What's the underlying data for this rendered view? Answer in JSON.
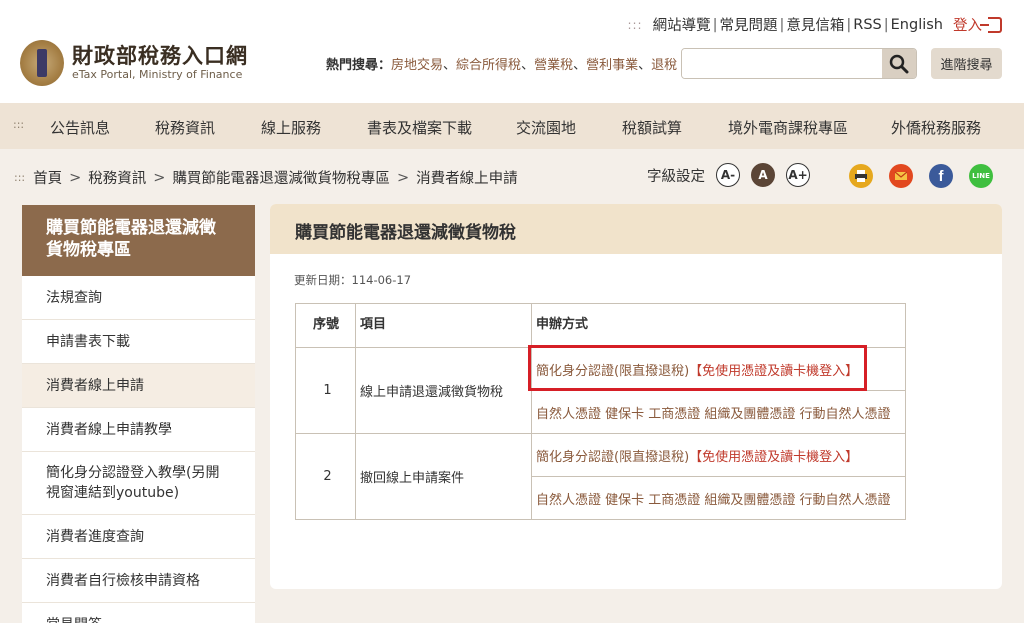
{
  "header": {
    "logo_cn": "財政部稅務入口網",
    "logo_en": "eTax Portal, Ministry of Finance",
    "toplinks": [
      "網站導覽",
      "常見問題",
      "意見信箱",
      "RSS",
      "English"
    ],
    "login": "登入",
    "hot_label": "熱門搜尋：",
    "hot_keywords": [
      "房地交易",
      "綜合所得稅",
      "營業稅",
      "營利事業",
      "退稅"
    ],
    "search_placeholder": "",
    "advanced_search": "進階搜尋"
  },
  "nav": {
    "items": [
      "公告訊息",
      "稅務資訊",
      "線上服務",
      "書表及檔案下載",
      "交流園地",
      "稅額試算",
      "境外電商課稅專區",
      "外僑稅務服務"
    ]
  },
  "breadcrumb": [
    "首頁",
    "稅務資訊",
    "購買節能電器退還減徵貨物稅專區",
    "消費者線上申請"
  ],
  "fontsize": {
    "label": "字級設定",
    "small": "A-",
    "normal": "A",
    "large": "A+"
  },
  "share_icons": [
    "print-icon",
    "mail-icon",
    "facebook-icon",
    "line-icon"
  ],
  "sidebar": {
    "title": "購買節能電器退還減徵貨物稅專區",
    "items": [
      "法規查詢",
      "申請書表下載",
      "消費者線上申請",
      "消費者線上申請教學",
      "簡化身分認證登入教學(另開視窗連結到youtube)",
      "消費者進度查詢",
      "消費者自行檢核申請資格",
      "常見問答"
    ],
    "active_index": 2
  },
  "content": {
    "title": "購買節能電器退還減徵貨物稅",
    "updated": "更新日期：114-06-17",
    "table": {
      "headers": [
        "序號",
        "項目",
        "申辦方式"
      ],
      "rows": [
        {
          "num": "1",
          "item": "線上申請退還減徵貨物稅",
          "method_simple": "簡化身分認證(限直撥退稅)",
          "method_simple_note": "【免使用憑證及讀卡機登入】",
          "method_cert": "自然人憑證 健保卡 工商憑證 組織及團體憑證 行動自然人憑證"
        },
        {
          "num": "2",
          "item": "撤回線上申請案件",
          "method_simple": "簡化身分認證(限直撥退稅)",
          "method_simple_note": "【免使用憑證及讀卡機登入】",
          "method_cert": "自然人憑證 健保卡 工商憑證 組織及團體憑證 行動自然人憑證"
        }
      ]
    }
  },
  "colors": {
    "brand": "#8c6a4c",
    "highlight": "#d61f26",
    "link": "#8a5a3c",
    "nav_bg": "#eee3d5"
  }
}
